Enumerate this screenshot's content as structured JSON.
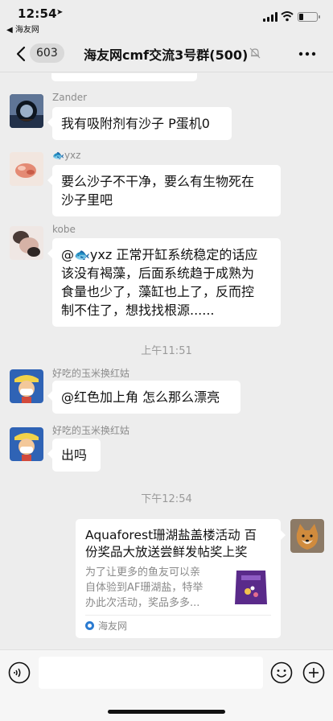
{
  "status": {
    "time": "12:54",
    "back_to_app": "◀ 海友网",
    "battery_level_fraction": 0.25
  },
  "nav": {
    "unread_count": "603",
    "title": "海友网cmf交流3号群(500)",
    "icons": [
      "chevron-left-icon",
      "mute-bell-icon",
      "more-dots-icon"
    ]
  },
  "messages": [
    {
      "sender": "Zander",
      "text": "我有吸附剂有沙子 P蛋机0"
    },
    {
      "sender": "🐟yxz",
      "text_lines": [
        "要么沙子不干净，要么有生物死在",
        "沙子里吧"
      ]
    },
    {
      "sender": "kobe",
      "text_lines": [
        "@🐟yxz 正常开缸系统稳定的话应",
        "该没有褐藻，后面系统趋于成熟为",
        "食量也少了，藻缸也上了，反而控",
        "制不住了，想找找根源......"
      ]
    },
    {
      "timestamp": "上午11:51"
    },
    {
      "sender": "好吃的玉米换红姑",
      "text": "@红色加上角 怎么那么漂亮"
    },
    {
      "sender": "好吃的玉米换红姑",
      "text": "出吗"
    },
    {
      "timestamp": "下午12:54"
    }
  ],
  "share_card": {
    "title_lines": [
      "Aquaforest珊湖盐盖楼活动 百",
      "份奖品大放送尝鲜发帖奖上奖"
    ],
    "desc_lines": [
      "为了让更多的鱼友可以亲",
      "自体验到AF珊湖盐，特举",
      "办此次活动，奖品多多..."
    ],
    "source": "海友网"
  },
  "input_bar": {
    "placeholder": "",
    "icons": [
      "voice-icon",
      "emoji-icon",
      "plus-icon"
    ]
  },
  "colors": {
    "background": "#ededed",
    "bubble": "#ffffff",
    "text": "#111111",
    "meta": "#8c8c8c"
  }
}
